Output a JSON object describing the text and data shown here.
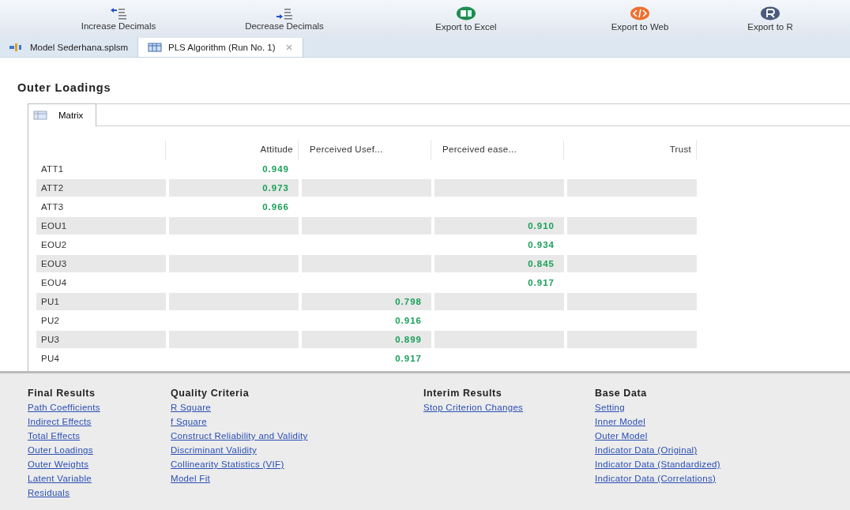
{
  "toolbar": [
    {
      "label": "Increase Decimals",
      "kind": "increase"
    },
    {
      "label": "Decrease Decimals",
      "kind": "decrease"
    },
    {
      "label": "Export to Excel",
      "kind": "excel"
    },
    {
      "label": "Export to Web",
      "kind": "web"
    },
    {
      "label": "Export to R",
      "kind": "r"
    }
  ],
  "editor_tabs": [
    {
      "label": "Model Sederhana.splsm",
      "kind": "model",
      "selected": false
    },
    {
      "label": "PLS Algorithm (Run No. 1)",
      "kind": "report",
      "selected": true
    }
  ],
  "title": "Outer Loadings",
  "view_tabs": [
    {
      "label": "Matrix",
      "selected": true
    }
  ],
  "table": {
    "columns": [
      "Attitude",
      "Perceived Usef...",
      "Perceived ease...",
      "Trust"
    ],
    "rows": [
      {
        "label": "ATT1",
        "column_1": "0.949"
      },
      {
        "label": "ATT2",
        "column_1": "0.973"
      },
      {
        "label": "ATT3",
        "column_1": "0.966"
      },
      {
        "label": "EOU1",
        "column_3": "0.910"
      },
      {
        "label": "EOU2",
        "column_3": "0.934"
      },
      {
        "label": "EOU3",
        "column_3": "0.845"
      },
      {
        "label": "EOU4",
        "column_3": "0.917"
      },
      {
        "label": "PU1",
        "column_2": "0.798"
      },
      {
        "label": "PU2",
        "column_2": "0.916"
      },
      {
        "label": "PU3",
        "column_2": "0.899"
      },
      {
        "label": "PU4",
        "column_2": "0.917"
      }
    ]
  },
  "link_groups": [
    {
      "heading": "Final Results",
      "links": [
        "Path Coefficients",
        "Indirect Effects",
        "Total Effects",
        "Outer Loadings",
        "Outer Weights",
        "Latent Variable",
        "Residuals"
      ]
    },
    {
      "heading": "Quality Criteria",
      "links": [
        "R Square",
        "f Square",
        "Construct Reliability and Validity",
        "Discriminant Validity",
        "Collinearity Statistics (VIF)",
        "Model Fit"
      ]
    },
    {
      "heading": "Interim Results",
      "links": [
        "Stop Criterion Changes"
      ]
    },
    {
      "heading": "Base Data",
      "links": [
        "Setting",
        "Inner Model",
        "Outer Model",
        "Indicator Data (Original)",
        "Indicator Data (Standardized)",
        "Indicator Data (Correlations)"
      ]
    }
  ]
}
